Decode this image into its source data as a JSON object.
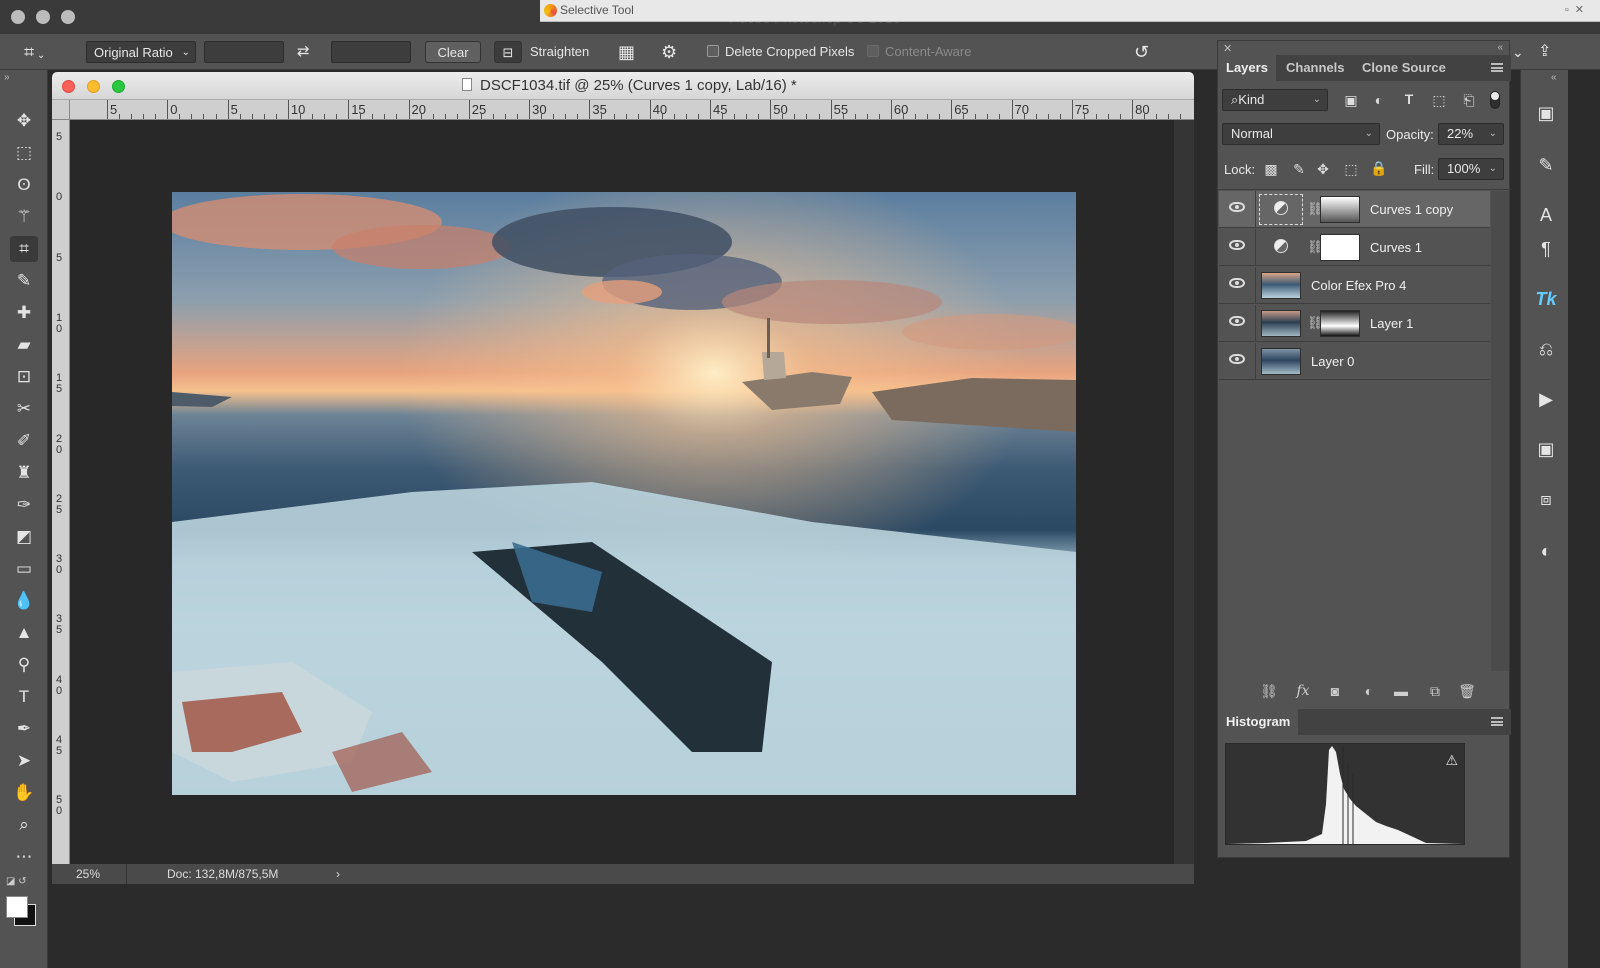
{
  "app": {
    "title": "Adobe Photoshop CC 2018"
  },
  "selective_tool": {
    "title": "Selective Tool"
  },
  "options_bar": {
    "ratio_label": "Original Ratio",
    "width_value": "",
    "height_value": "",
    "clear_label": "Clear",
    "straighten_label": "Straighten",
    "delete_cropped_label": "Delete Cropped Pixels",
    "content_aware_label": "Content-Aware"
  },
  "tools": [
    "move-tool",
    "marquee-tool",
    "lasso-tool",
    "magic-wand-tool",
    "crop-tool",
    "eyedropper-tool",
    "healing-brush-tool",
    "brush-tool",
    "clone-stamp-tool",
    "history-brush-tool",
    "eraser-tool",
    "gradient-tool",
    "blur-tool",
    "dodge-tool",
    "pen-tool",
    "type-tool",
    "path-selection-tool",
    "hand-tool",
    "zoom-tool"
  ],
  "document": {
    "title": "DSCF1034.tif @ 25% (Curves 1 copy, Lab/16) *",
    "ruler_top": [
      "5",
      "0",
      "5",
      "10",
      "15",
      "20",
      "25",
      "30",
      "35",
      "40",
      "45",
      "50",
      "55",
      "60",
      "65",
      "70",
      "75",
      "80"
    ],
    "ruler_left": [
      "5",
      "0",
      "5",
      "10",
      "15",
      "20",
      "25",
      "30",
      "35",
      "40",
      "45",
      "50"
    ],
    "zoom": "25%",
    "doc_info": "Doc: 132,8M/875,5M"
  },
  "layers_panel": {
    "tabs": [
      "Layers",
      "Channels",
      "Clone Source"
    ],
    "filter_kind": "Kind",
    "blend_mode": "Normal",
    "opacity_label": "Opacity:",
    "opacity_value": "22%",
    "lock_label": "Lock:",
    "fill_label": "Fill:",
    "fill_value": "100%",
    "layers": [
      {
        "name": "Curves 1 copy",
        "selected": true,
        "type": "adjustment"
      },
      {
        "name": "Curves 1",
        "selected": false,
        "type": "adjustment"
      },
      {
        "name": "Color Efex Pro 4",
        "selected": false,
        "type": "image"
      },
      {
        "name": "Layer 1",
        "selected": false,
        "type": "image-mask"
      },
      {
        "name": "Layer 0",
        "selected": false,
        "type": "image"
      }
    ]
  },
  "histogram_panel": {
    "title": "Histogram"
  },
  "colors": {
    "accent_sky": "#f6c08e",
    "panel_bg": "#535353",
    "canvas_bg": "#282828"
  }
}
